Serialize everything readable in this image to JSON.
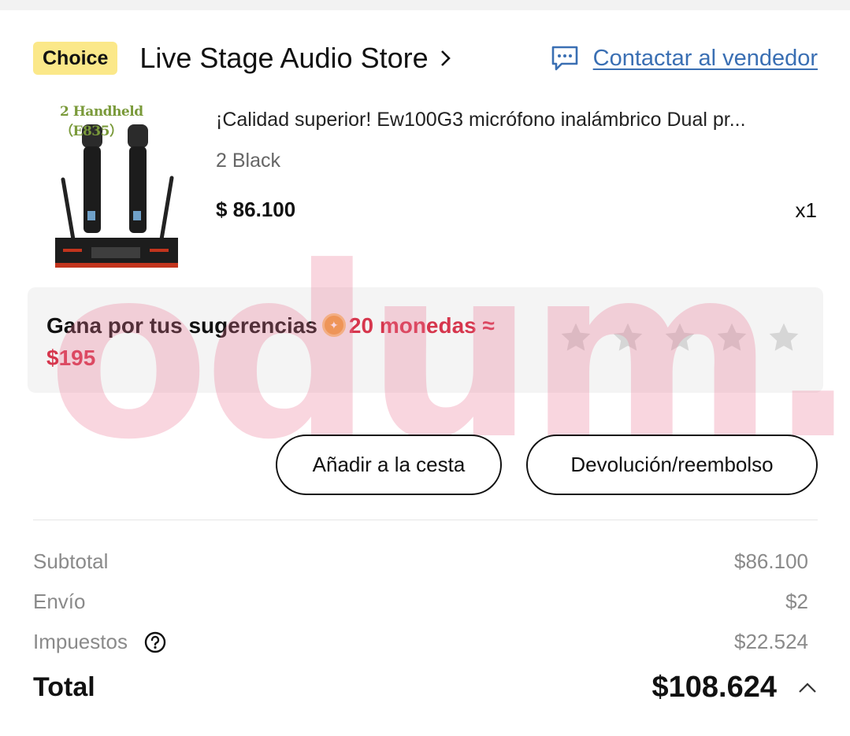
{
  "store": {
    "badge": "Choice",
    "name": "Live Stage Audio Store",
    "contact_label": "Contactar al vendedor"
  },
  "product": {
    "image_caption": "2 Handheld（E835）",
    "title": "¡Calidad superior! Ew100G3 micrófono inalámbrico Dual pr...",
    "variant": "2 Black",
    "price": "$ 86.100",
    "quantity": "x1"
  },
  "rewards": {
    "prompt": "Gana por tus sugerencias",
    "coins": "20 monedas ≈",
    "value": "$195",
    "rating_stars": 5,
    "rating_selected": 0
  },
  "watermark": "odum.cl",
  "actions": {
    "add_to_cart": "Añadir a la cesta",
    "refund": "Devolución/reembolso"
  },
  "summary": {
    "subtotal_label": "Subtotal",
    "subtotal_value": "$86.100",
    "shipping_label": "Envío",
    "shipping_value": "$2",
    "taxes_label": "Impuestos",
    "taxes_value": "$22.524",
    "total_label": "Total",
    "total_value": "$108.624"
  },
  "colors": {
    "choice_badge": "#fbe889",
    "link": "#3a6fb3",
    "reward_accent": "#d6364d",
    "coin": "#f0a23e"
  },
  "icons": [
    "chevron-right-icon",
    "chat-icon",
    "coin-icon",
    "star-icon",
    "help-icon",
    "chevron-up-icon"
  ]
}
